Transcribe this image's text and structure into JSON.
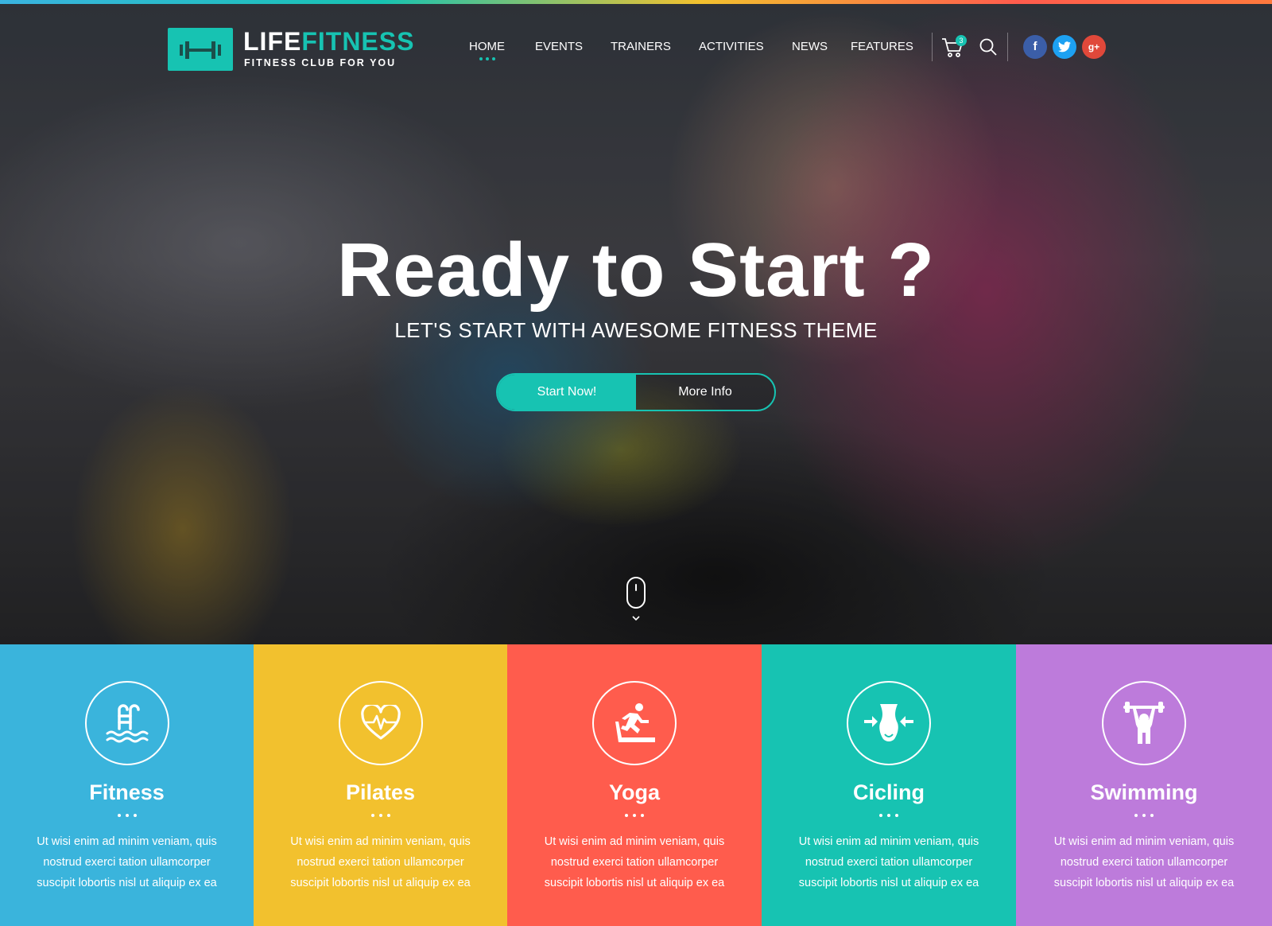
{
  "brand": {
    "name_part1": "LIFE",
    "name_part2": "FITNESS",
    "tagline": "FITNESS CLUB FOR YOU",
    "accent_color": "#17c3b2"
  },
  "nav": {
    "items": [
      {
        "label": "HOME",
        "active": true
      },
      {
        "label": "EVENTS"
      },
      {
        "label": "TRAINERS"
      },
      {
        "label": "ACTIVITIES"
      },
      {
        "label": "NEWS"
      },
      {
        "label": "FEATURES"
      }
    ],
    "cart_count": "3",
    "cart_icon": "cart-icon",
    "search_icon": "search-icon",
    "social": [
      {
        "icon": "facebook-icon",
        "glyph": "f",
        "color": "#3b5ea8"
      },
      {
        "icon": "twitter-icon",
        "glyph": "t",
        "color": "#1da1f2"
      },
      {
        "icon": "google-plus-icon",
        "glyph": "g+",
        "color": "#e0483a"
      }
    ]
  },
  "hero": {
    "title": "Ready to Start ?",
    "subtitle": "LET'S START WITH AWESOME FITNESS THEME",
    "primary_button": "Start Now!",
    "secondary_button": "More Info",
    "scroll_icon": "mouse-scroll-icon"
  },
  "features": [
    {
      "title": "Fitness",
      "icon": "pool-ladder-icon",
      "color": "#3ab4dc",
      "text": "Ut wisi enim ad minim veniam, quis nostrud exerci tation ullamcorper suscipit lobortis nisl ut aliquip ex ea"
    },
    {
      "title": "Pilates",
      "icon": "heart-pulse-icon",
      "color": "#f2c12e",
      "text": "Ut wisi enim ad minim veniam, quis nostrud exerci tation ullamcorper suscipit lobortis nisl ut aliquip ex ea"
    },
    {
      "title": "Yoga",
      "icon": "treadmill-runner-icon",
      "color": "#ff5c4d",
      "text": "Ut wisi enim ad minim veniam, quis nostrud exerci tation ullamcorper suscipit lobortis nisl ut aliquip ex ea"
    },
    {
      "title": "Cicling",
      "icon": "waist-icon",
      "color": "#17c3b2",
      "text": "Ut wisi enim ad minim veniam, quis nostrud exerci tation ullamcorper suscipit lobortis nisl ut aliquip ex ea"
    },
    {
      "title": "Swimming",
      "icon": "weightlifter-icon",
      "color": "#bd7bdb",
      "text": "Ut wisi enim ad minim veniam, quis nostrud exerci tation ullamcorper suscipit lobortis nisl ut aliquip ex ea"
    }
  ]
}
